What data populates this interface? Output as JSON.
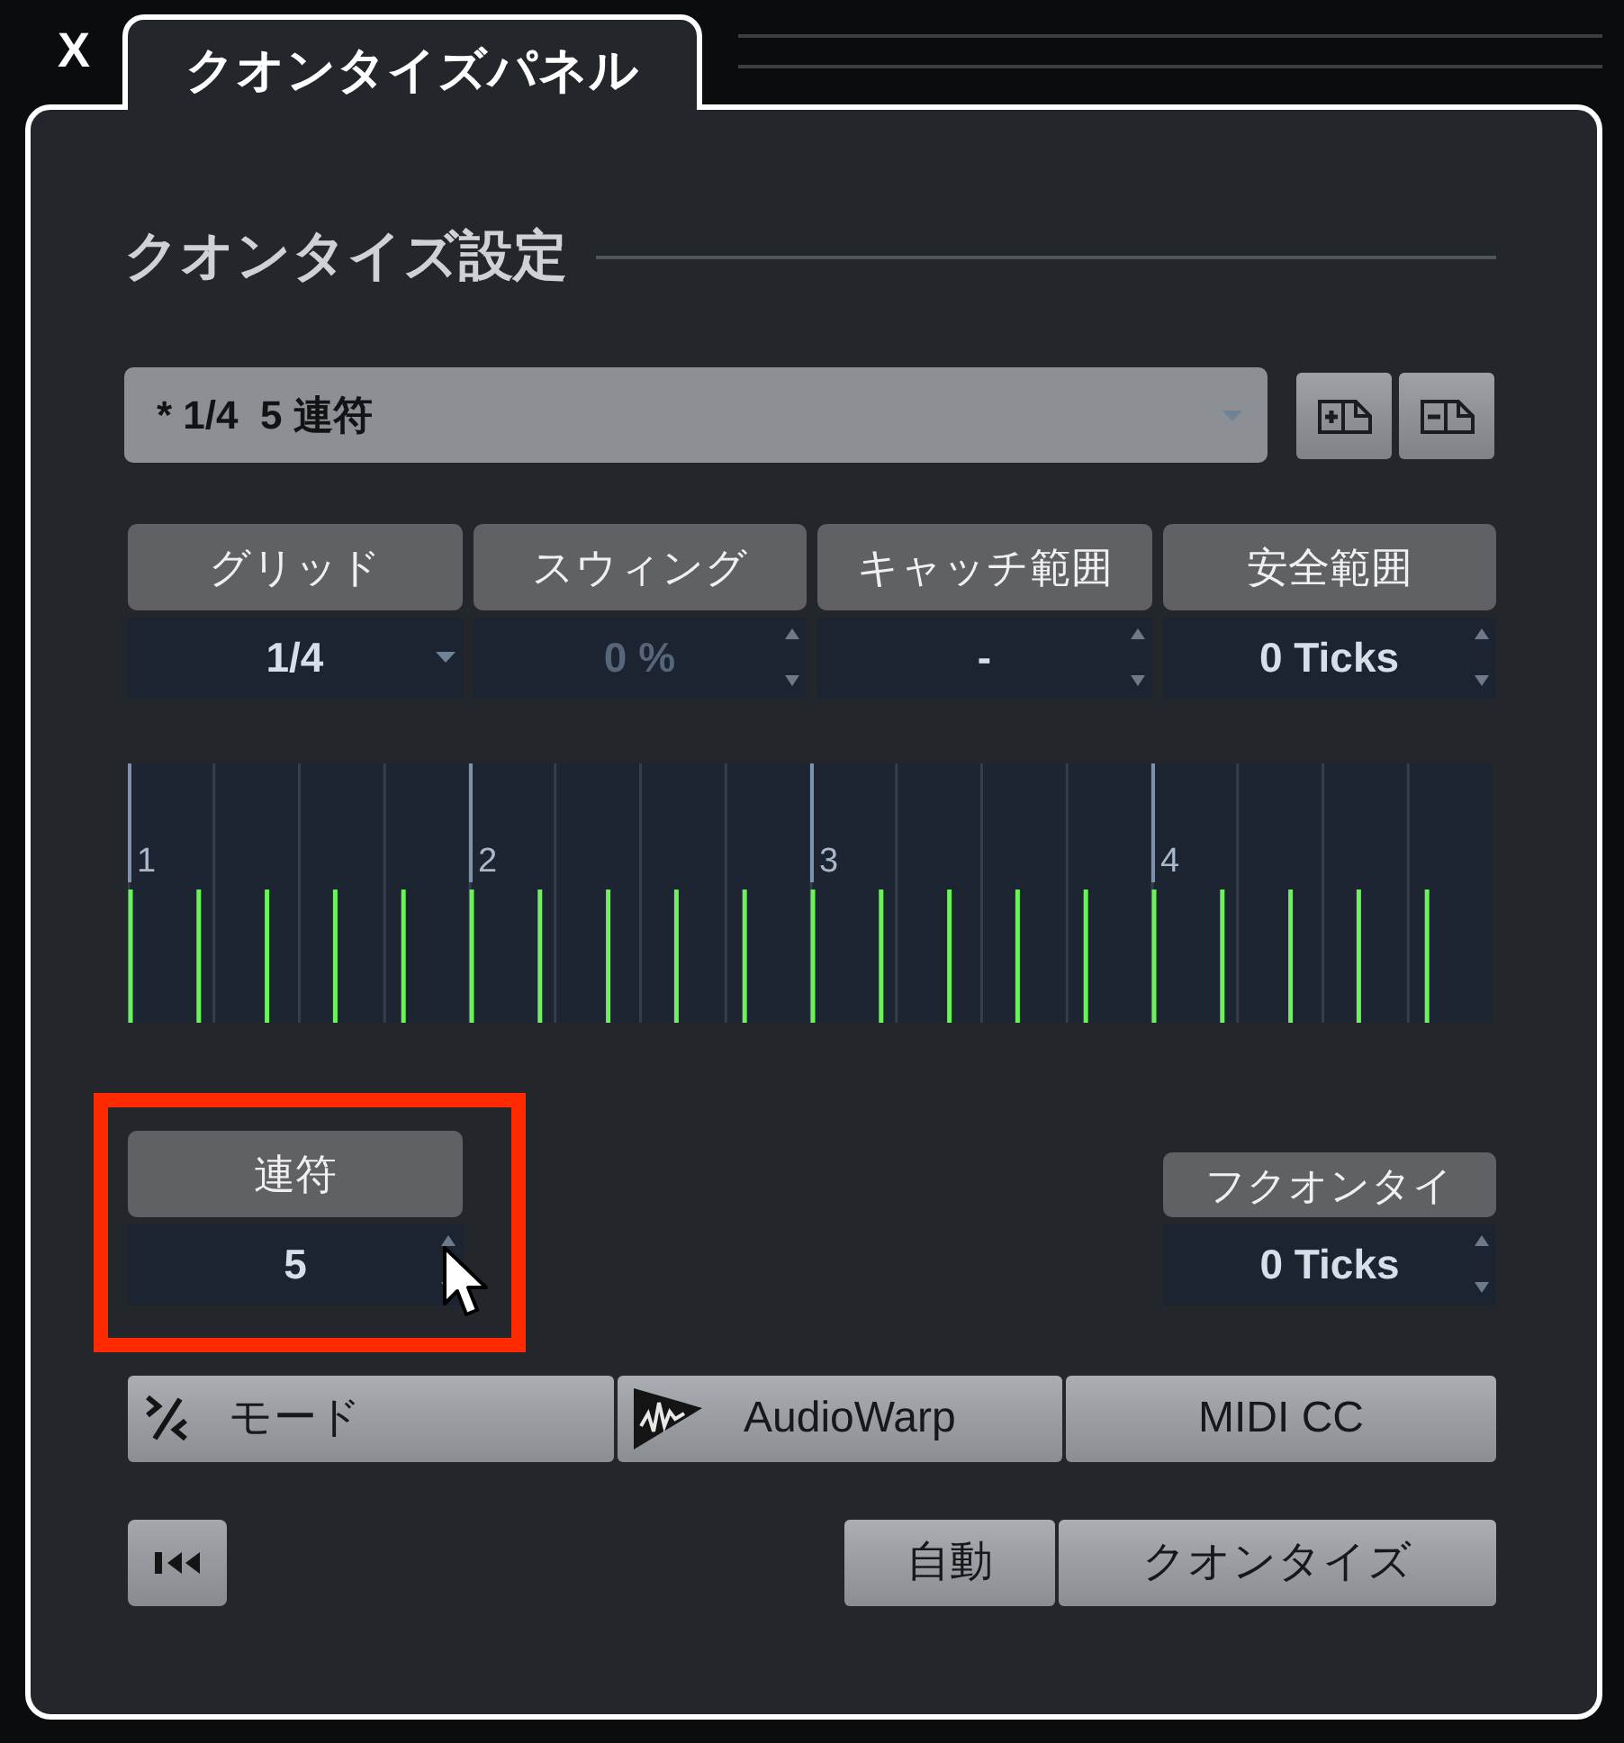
{
  "window": {
    "close_label": "X"
  },
  "tabs": [
    {
      "label": "クオンタイズパネル",
      "selected": true
    }
  ],
  "section": {
    "title": "クオンタイズ設定"
  },
  "preset": {
    "value": "* 1/4  5 連符"
  },
  "parameters": [
    {
      "label": "グリッド",
      "value": "1/4",
      "kind": "dropdown",
      "disabled": false
    },
    {
      "label": "スウィング",
      "value": "0 %",
      "kind": "spinner",
      "disabled": true
    },
    {
      "label": "キャッチ範囲",
      "value": "-",
      "kind": "spinner",
      "disabled": false
    },
    {
      "label": "安全範囲",
      "value": "0 Ticks",
      "kind": "spinner",
      "disabled": false
    }
  ],
  "grid_display": {
    "beat_labels": [
      "1",
      "2",
      "3",
      "4"
    ]
  },
  "tuplet": {
    "label": "連符",
    "value": "5",
    "highlighted": true
  },
  "rough_quantize": {
    "label": "フクオンタイ",
    "value": "0 Ticks"
  },
  "mode_buttons": [
    {
      "label": "モード",
      "kind": "mode"
    },
    {
      "label": "AudioWarp",
      "kind": "audiowarp"
    },
    {
      "label": "MIDI CC",
      "kind": "plain"
    }
  ],
  "action_buttons": [
    "自動",
    "クオンタイズ"
  ]
}
